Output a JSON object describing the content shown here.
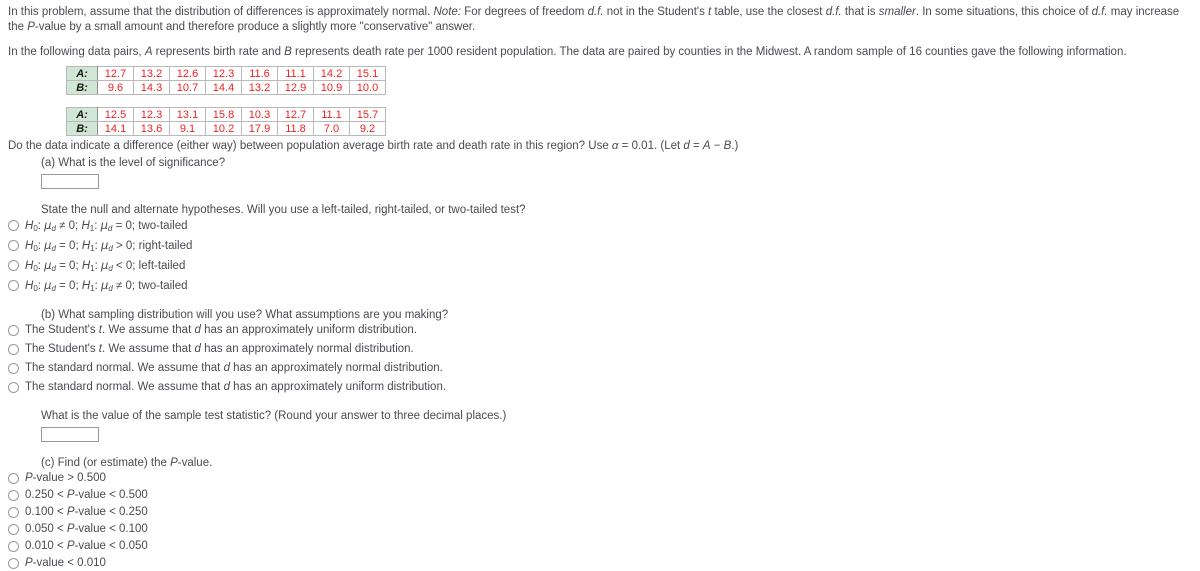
{
  "intro": {
    "paragraph1": "In this problem, assume that the distribution of differences is approximately normal. Note: For degrees of freedom d.f. not in the Student's t table, use the closest d.f. that is smaller. In some situations, this choice of d.f. may increase the P-value by a small amount and therefore produce a slightly more \"conservative\" answer.",
    "paragraph2": "In the following data pairs, A represents birth rate and B represents death rate per 1000 resident population. The data are paired by counties in the Midwest. A random sample of 16 counties gave the following information."
  },
  "tables": [
    {
      "row_a_label": "A:",
      "row_b_label": "B:",
      "row_a": [
        "12.7",
        "13.2",
        "12.6",
        "12.3",
        "11.6",
        "11.1",
        "14.2",
        "15.1"
      ],
      "row_b": [
        "9.6",
        "14.3",
        "10.7",
        "14.4",
        "13.2",
        "12.9",
        "10.9",
        "10.0"
      ]
    },
    {
      "row_a_label": "A:",
      "row_b_label": "B:",
      "row_a": [
        "12.5",
        "12.3",
        "13.1",
        "15.8",
        "10.3",
        "12.7",
        "11.1",
        "15.7"
      ],
      "row_b": [
        "14.1",
        "13.6",
        "9.1",
        "10.2",
        "17.9",
        "11.8",
        "7.0",
        "9.2"
      ]
    }
  ],
  "prompt": "Do the data indicate a difference (either way) between population average birth rate and death rate in this region? Use α = 0.01. (Let d = A − B.)",
  "part_a": {
    "question": "(a) What is the level of significance?",
    "answer_value": "",
    "hypotheses_question": "State the null and alternate hypotheses. Will you use a left-tailed, right-tailed, or two-tailed test?",
    "options": [
      "H₀: μd ≠ 0; H₁: μd = 0; two-tailed",
      "H₀: μd = 0; H₁: μd > 0; right-tailed",
      "H₀: μd = 0; H₁: μd < 0; left-tailed",
      "H₀: μd = 0; H₁: μd ≠ 0; two-tailed"
    ]
  },
  "part_b": {
    "question": "(b) What sampling distribution will you use? What assumptions are you making?",
    "options": [
      "The Student's t. We assume that d has an approximately uniform distribution.",
      "The Student's t. We assume that d has an approximately normal distribution.",
      "The standard normal. We assume that d has an approximately normal distribution.",
      "The standard normal. We assume that d has an approximately uniform distribution."
    ]
  },
  "test_statistic": {
    "question": "What is the value of the sample test statistic? (Round your answer to three decimal places.)",
    "answer_value": ""
  },
  "part_c": {
    "question": "(c) Find (or estimate) the P-value.",
    "options": [
      "P-value > 0.500",
      "0.250 < P-value < 0.500",
      "0.100 < P-value < 0.250",
      "0.050 < P-value < 0.100",
      "0.010 < P-value < 0.050",
      "P-value < 0.010"
    ]
  },
  "colors": {
    "text": "#4a4a52",
    "data_value": "#ee2222",
    "table_header_bg": "#cfe7d4"
  }
}
